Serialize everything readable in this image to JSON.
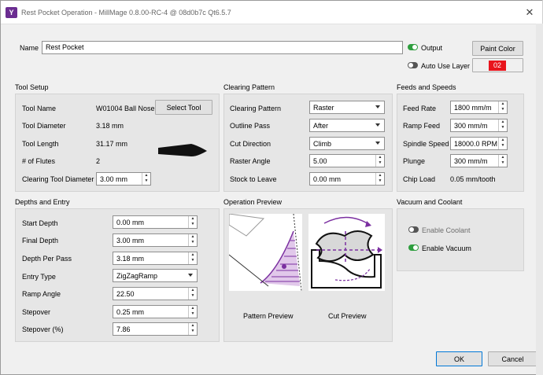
{
  "window": {
    "title": "Rest Pocket Operation - MillMage 0.8.00-RC-4 @ 08d0b7c Qt6.5.7",
    "app_icon": "Y"
  },
  "name": {
    "label": "Name",
    "value": "Rest Pocket"
  },
  "output": {
    "label": "Output",
    "on": true
  },
  "auto_use_layer": {
    "label": "Auto Use Layer",
    "on": false
  },
  "paint_color": {
    "label": "Paint Color"
  },
  "layer": {
    "value": "02",
    "color": "#e8141c"
  },
  "tool_setup": {
    "title": "Tool Setup",
    "tool_name_label": "Tool Name",
    "tool_name_value": "W01004 Ball Nose",
    "select_tool": "Select Tool",
    "diameter_label": "Tool Diameter",
    "diameter_value": "3.18 mm",
    "length_label": "Tool Length",
    "length_value": "31.17 mm",
    "flutes_label": "# of Flutes",
    "flutes_value": "2",
    "clearing_label": "Clearing Tool Diameter",
    "clearing_value": "3.00 mm"
  },
  "clearing_pattern": {
    "title": "Clearing Pattern",
    "pattern_label": "Clearing Pattern",
    "pattern_value": "Raster",
    "outline_label": "Outline Pass",
    "outline_value": "After",
    "direction_label": "Cut Direction",
    "direction_value": "Climb",
    "raster_label": "Raster Angle",
    "raster_value": "5.00",
    "stock_label": "Stock to Leave",
    "stock_value": "0.00 mm"
  },
  "feeds": {
    "title": "Feeds and Speeds",
    "feed_label": "Feed Rate",
    "feed_value": "1800 mm/m",
    "ramp_label": "Ramp Feed",
    "ramp_value": "300 mm/m",
    "spindle_label": "Spindle Speed",
    "spindle_value": "18000.0 RPM",
    "plunge_label": "Plunge",
    "plunge_value": "300 mm/m",
    "chip_label": "Chip Load",
    "chip_value": "0.05 mm/tooth"
  },
  "depths": {
    "title": "Depths and Entry",
    "start_label": "Start Depth",
    "start_value": "0.00 mm",
    "final_label": "Final Depth",
    "final_value": "3.00 mm",
    "perpass_label": "Depth Per Pass",
    "perpass_value": "3.18 mm",
    "entry_label": "Entry Type",
    "entry_value": "ZigZagRamp",
    "ramp_label": "Ramp Angle",
    "ramp_value": "22.50",
    "stepover_label": "Stepover",
    "stepover_value": "0.25 mm",
    "stepover_pct_label": "Stepover (%)",
    "stepover_pct_value": "7.86"
  },
  "preview": {
    "title": "Operation Preview",
    "pattern_caption": "Pattern Preview",
    "cut_caption": "Cut Preview"
  },
  "vacuum": {
    "title": "Vacuum and Coolant",
    "coolant_label": "Enable Coolant",
    "coolant_on": false,
    "vacuum_label": "Enable Vacuum",
    "vacuum_on": true
  },
  "ok": "OK",
  "cancel": "Cancel",
  "accent": "#7b2fa0",
  "toggle_on": "#2e9e3e",
  "toggle_off": "#555555"
}
